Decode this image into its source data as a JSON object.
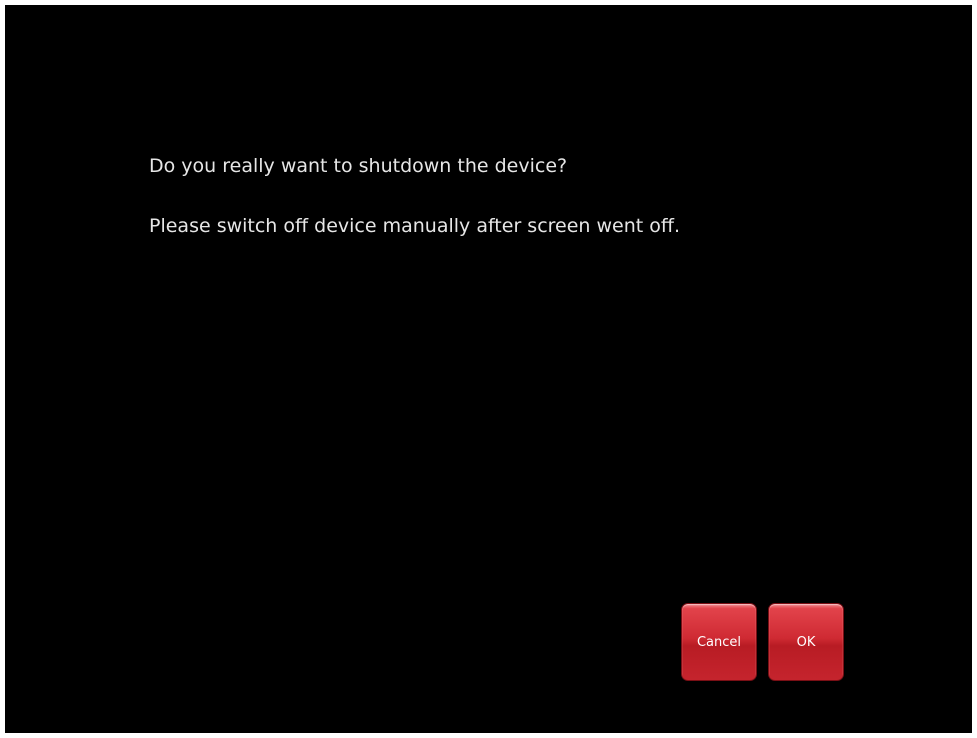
{
  "dialog": {
    "question": "Do you really want to shutdown the device?",
    "note": "Please switch off device manually after screen went off.",
    "cancel_label": "Cancel",
    "ok_label": "OK"
  },
  "colors": {
    "background": "#000000",
    "text": "#e6e6e6",
    "button": "#cf2a33"
  }
}
